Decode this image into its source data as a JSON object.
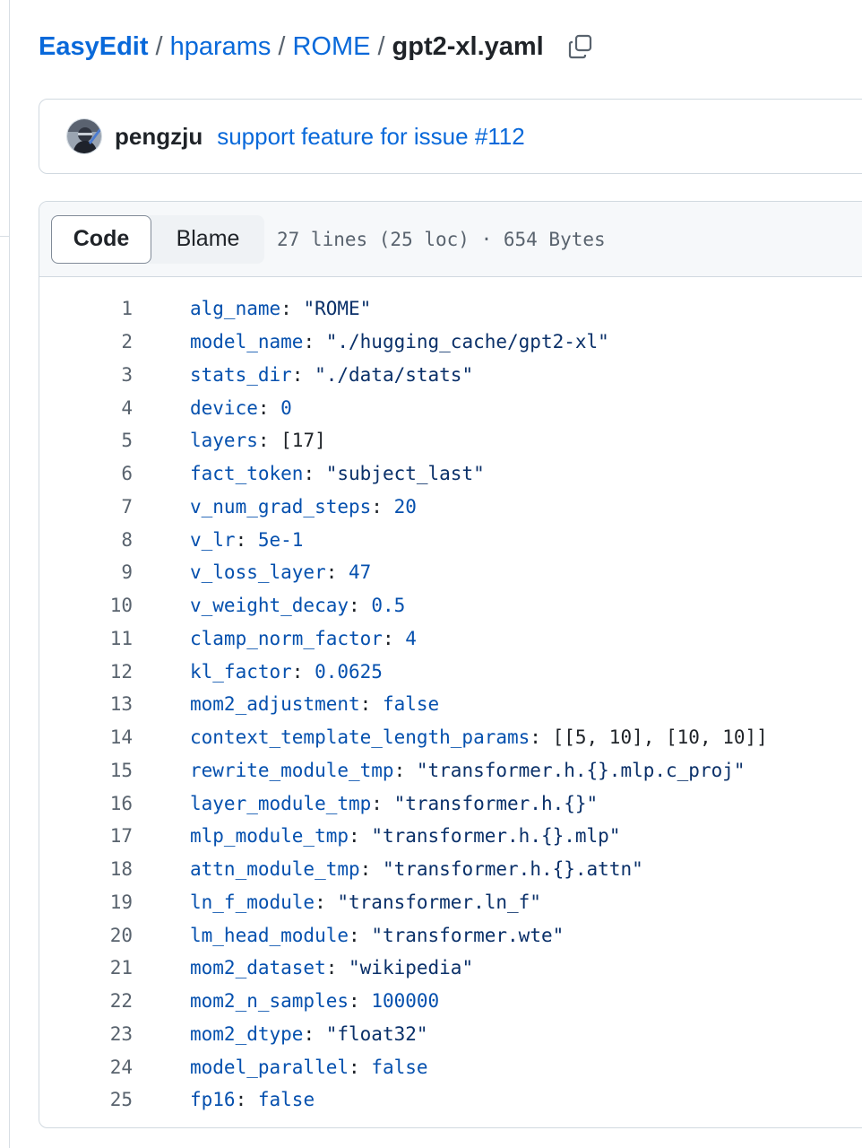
{
  "breadcrumb": {
    "repo": "EasyEdit",
    "sep": "/",
    "path": [
      "hparams",
      "ROME"
    ],
    "file": "gpt2-xl.yaml"
  },
  "icons": {
    "copy": "copy-icon",
    "avatar": "avatar-image"
  },
  "commit": {
    "author": "pengzju",
    "message": "support feature for issue #112"
  },
  "file_header": {
    "tabs": [
      "Code",
      "Blame"
    ],
    "active_tab": "Code",
    "meta": "27 lines (25 loc) · 654 Bytes"
  },
  "code": {
    "lines": [
      {
        "n": "1",
        "key": "alg_name",
        "sep": ": ",
        "val": "\"ROME\"",
        "kind": "string"
      },
      {
        "n": "2",
        "key": "model_name",
        "sep": ": ",
        "val": "\"./hugging_cache/gpt2-xl\"",
        "kind": "string"
      },
      {
        "n": "3",
        "key": "stats_dir",
        "sep": ": ",
        "val": "\"./data/stats\"",
        "kind": "string"
      },
      {
        "n": "4",
        "key": "device",
        "sep": ": ",
        "val": "0",
        "kind": "value"
      },
      {
        "n": "5",
        "key": "layers",
        "sep": ": ",
        "val": "[17]",
        "kind": "plain"
      },
      {
        "n": "6",
        "key": "fact_token",
        "sep": ": ",
        "val": "\"subject_last\"",
        "kind": "string"
      },
      {
        "n": "7",
        "key": "v_num_grad_steps",
        "sep": ": ",
        "val": "20",
        "kind": "value"
      },
      {
        "n": "8",
        "key": "v_lr",
        "sep": ": ",
        "val": "5e-1",
        "kind": "value"
      },
      {
        "n": "9",
        "key": "v_loss_layer",
        "sep": ": ",
        "val": "47",
        "kind": "value"
      },
      {
        "n": "10",
        "key": "v_weight_decay",
        "sep": ": ",
        "val": "0.5",
        "kind": "value"
      },
      {
        "n": "11",
        "key": "clamp_norm_factor",
        "sep": ": ",
        "val": "4",
        "kind": "value"
      },
      {
        "n": "12",
        "key": "kl_factor",
        "sep": ": ",
        "val": "0.0625",
        "kind": "value"
      },
      {
        "n": "13",
        "key": "mom2_adjustment",
        "sep": ": ",
        "val": "false",
        "kind": "value"
      },
      {
        "n": "14",
        "key": "context_template_length_params",
        "sep": ": ",
        "val": "[[5, 10], [10, 10]]",
        "kind": "plain"
      },
      {
        "n": "15",
        "key": "rewrite_module_tmp",
        "sep": ": ",
        "val": "\"transformer.h.{}.mlp.c_proj\"",
        "kind": "string"
      },
      {
        "n": "16",
        "key": "layer_module_tmp",
        "sep": ": ",
        "val": "\"transformer.h.{}\"",
        "kind": "string"
      },
      {
        "n": "17",
        "key": "mlp_module_tmp",
        "sep": ": ",
        "val": "\"transformer.h.{}.mlp\"",
        "kind": "string"
      },
      {
        "n": "18",
        "key": "attn_module_tmp",
        "sep": ": ",
        "val": "\"transformer.h.{}.attn\"",
        "kind": "string"
      },
      {
        "n": "19",
        "key": "ln_f_module",
        "sep": ": ",
        "val": "\"transformer.ln_f\"",
        "kind": "string"
      },
      {
        "n": "20",
        "key": "lm_head_module",
        "sep": ": ",
        "val": "\"transformer.wte\"",
        "kind": "string"
      },
      {
        "n": "21",
        "key": "mom2_dataset",
        "sep": ": ",
        "val": "\"wikipedia\"",
        "kind": "string"
      },
      {
        "n": "22",
        "key": "mom2_n_samples",
        "sep": ": ",
        "val": "100000",
        "kind": "value"
      },
      {
        "n": "23",
        "key": "mom2_dtype",
        "sep": ": ",
        "val": "\"float32\"",
        "kind": "string"
      },
      {
        "n": "24",
        "key": "model_parallel",
        "sep": ": ",
        "val": "false",
        "kind": "value"
      },
      {
        "n": "25",
        "key": "fp16",
        "sep": ": ",
        "val": "false",
        "kind": "value"
      }
    ]
  },
  "colors": {
    "link": "#0969da",
    "key": "#0550ae",
    "string": "#0a3069",
    "muted": "#59636e",
    "border": "#d1d9e0"
  }
}
